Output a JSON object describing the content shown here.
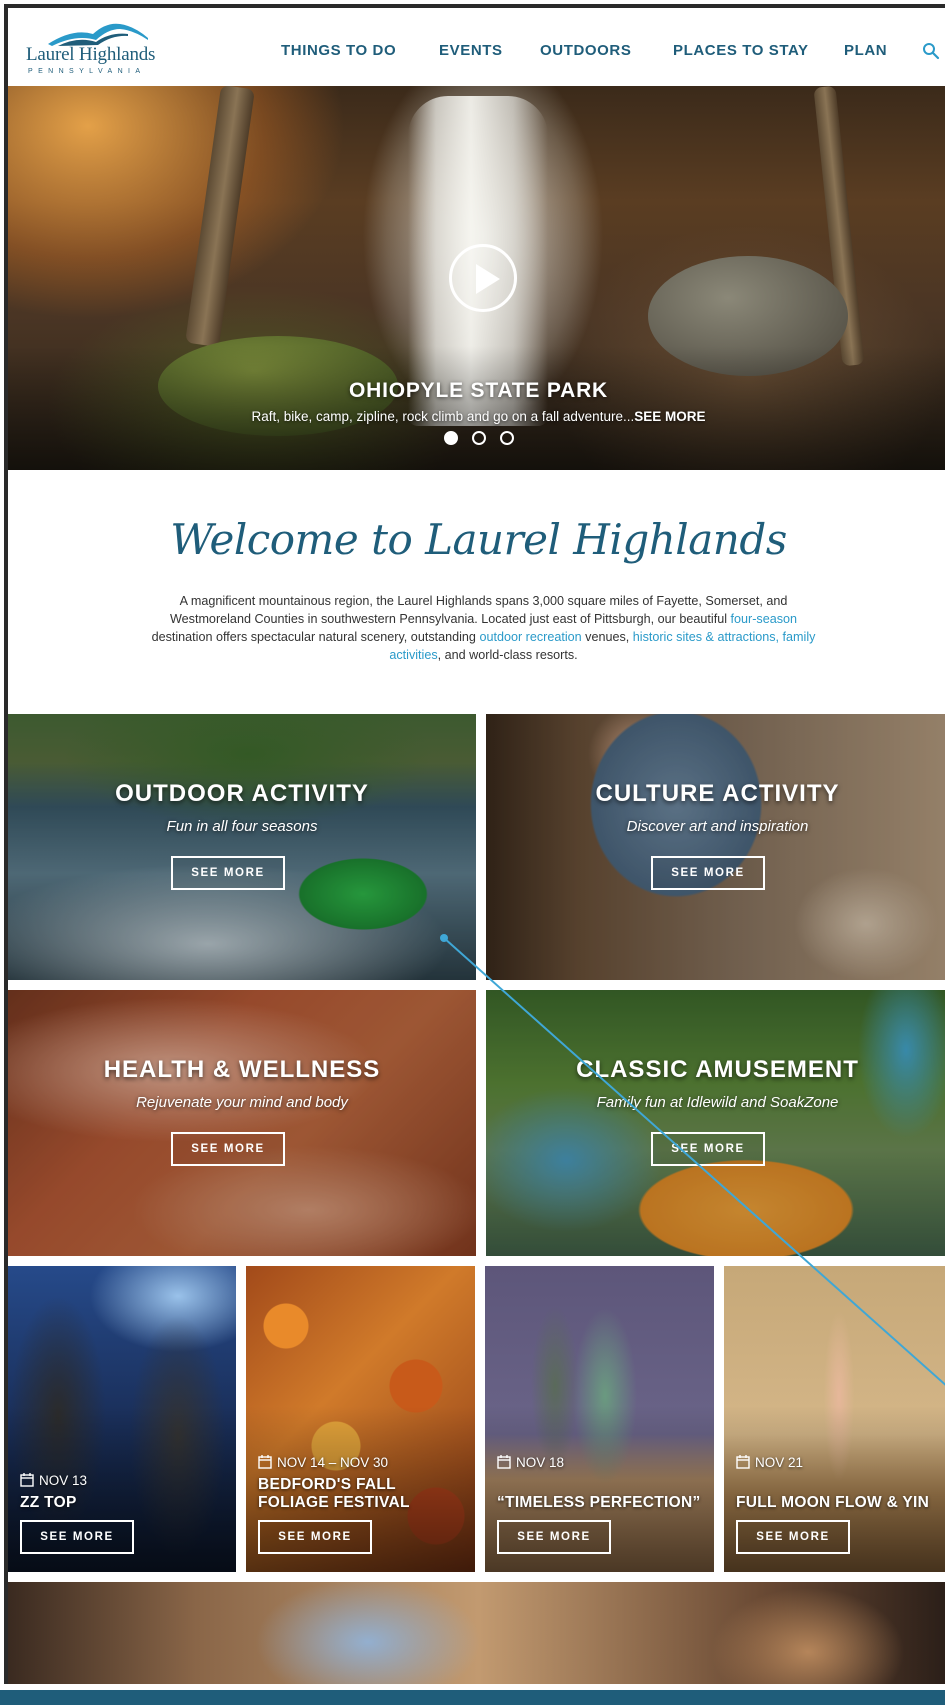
{
  "logo": {
    "name": "Laurel Highlands",
    "state": "PENNSYLVANIA"
  },
  "nav": {
    "items": [
      "THINGS TO DO",
      "EVENTS",
      "OUTDOORS",
      "PLACES TO STAY",
      "PLAN"
    ],
    "search_icon": "search-icon"
  },
  "hero": {
    "title": "OHIOPYLE STATE PARK",
    "description": "Raft, bike, camp, zipline, rock climb and go on a fall adventure...",
    "see_more": "SEE MORE",
    "slides_total": 3,
    "active_slide": 1
  },
  "welcome": {
    "title": "Welcome to Laurel Highlands",
    "p1": "A magnificent mountainous region, the Laurel Highlands spans 3,000 square miles of Fayette, Somerset, and Westmoreland Counties in southwestern Pennsylvania. Located just east of Pittsburgh, our beautiful ",
    "link_four_season": "four-season",
    "p2": " destination offers spectacular natural scenery, outstanding ",
    "link_outdoor": "outdoor recreation",
    "p3": " venues, ",
    "link_historic": "historic sites & attractions,",
    "p4": " ",
    "link_family": "family activities",
    "p5": ", and world-class resorts."
  },
  "activities": [
    {
      "title": "OUTDOOR ACTIVITY",
      "subtitle": "Fun in all four seasons",
      "button": "SEE MORE"
    },
    {
      "title": "CULTURE ACTIVITY",
      "subtitle": "Discover art and inspiration",
      "button": "SEE MORE"
    },
    {
      "title": "HEALTH & WELLNESS",
      "subtitle": "Rejuvenate your mind and body",
      "button": "SEE MORE"
    },
    {
      "title": "CLASSIC AMUSEMENT",
      "subtitle": "Family fun at Idlewild and SoakZone",
      "button": "SEE MORE"
    }
  ],
  "events": [
    {
      "date": "NOV 13",
      "title": "ZZ TOP",
      "button": "SEE MORE"
    },
    {
      "date": "NOV 14 – NOV 30",
      "title": "BEDFORD'S FALL FOLIAGE FESTIVAL",
      "button": "SEE MORE"
    },
    {
      "date": "NOV 18",
      "title": "“TIMELESS PERFECTION”",
      "button": "SEE MORE"
    },
    {
      "date": "NOV 21",
      "title": "FULL MOON FLOW & YIN",
      "button": "SEE MORE"
    }
  ],
  "colors": {
    "brand": "#1f5d7a",
    "link": "#2a9ac9",
    "footer": "#1f5d7a"
  }
}
